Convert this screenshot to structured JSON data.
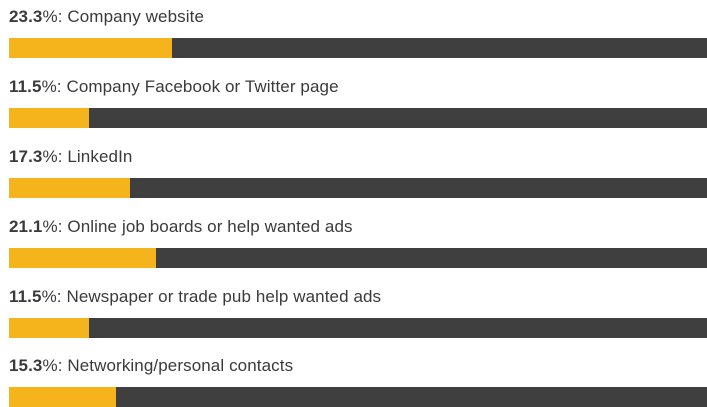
{
  "colors": {
    "fill": "#f5b31c",
    "track": "#3f3f3f",
    "text": "#3a3a3a"
  },
  "chart_data": {
    "type": "bar",
    "orientation": "horizontal",
    "value_suffix": "%",
    "xlim": [
      0,
      100
    ],
    "grid": false,
    "categories": [
      "Company website",
      "Company Facebook or Twitter page",
      "LinkedIn",
      "Online job boards or help wanted ads",
      "Newspaper or trade pub help wanted ads",
      "Networking/personal contacts"
    ],
    "values": [
      23.3,
      11.5,
      17.3,
      21.1,
      11.5,
      15.3
    ],
    "value_labels": [
      "23.3",
      "11.5",
      "17.3",
      "21.1",
      "11.5",
      "15.3"
    ]
  }
}
